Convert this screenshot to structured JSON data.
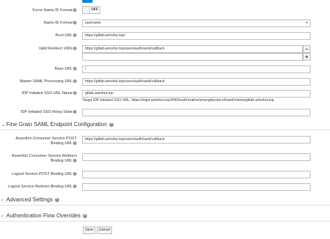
{
  "form": {
    "force_name_id_format": {
      "label": "Force Name ID Format",
      "value": "OFF"
    },
    "name_id_format": {
      "label": "Name ID Format",
      "value": "username"
    },
    "root_url": {
      "label": "Root URL",
      "value": "https://gitlab.arieshui.top/"
    },
    "valid_redirect_uris": {
      "label": "Valid Redirect URIs",
      "value": "https://gitlab.arieshui.top/users/auth/saml/callback",
      "remove_label": "−",
      "add_label": "+"
    },
    "base_url": {
      "label": "Base URL",
      "value": "/"
    },
    "master_saml_processing_url": {
      "label": "Master SAML Processing URL",
      "value": "https://gitlab.arieshui.top/users/auth/saml/callback"
    },
    "idp_initiated_sso_url_name": {
      "label": "IDP Initiated SSO URL Name",
      "value": "gitlab.arieshui.top",
      "hint": "Target IDP initiated SSO URL: https://login.arieshui.top:8443/auth/realms/yinengi/protocol/saml/clients/gitlab.arieshui.top"
    },
    "idp_initiated_sso_relay_state": {
      "label": "IDP Initiated SSO Relay State",
      "value": ""
    }
  },
  "fine_grain": {
    "title": "Fine Grain SAML Endpoint Configuration",
    "acs_post": {
      "label_line1": "Assertion Consumer Service POST",
      "label_line2": "Binding URL",
      "value": "https://gitlab.arieshui.top/users/auth/saml/callback"
    },
    "acs_redirect": {
      "label_line1": "Assertion Consumer Service Redirect",
      "label_line2": "Binding URL",
      "value": ""
    },
    "logout_post": {
      "label": "Logout Service POST Binding URL",
      "value": ""
    },
    "logout_redirect": {
      "label": "Logout Service Redirect Binding URL",
      "value": ""
    }
  },
  "sections": {
    "advanced_settings": "Advanced Settings",
    "auth_flow_overrides": "Authentication Flow Overrides"
  },
  "actions": {
    "save": "Save",
    "cancel": "Cancel"
  },
  "icons": {
    "help": "question-circle-icon",
    "expand": "chevron-right-icon",
    "collapse": "chevron-down-icon",
    "dropdown": "caret-down-icon"
  },
  "colors": {
    "toggle_on": "#0088ce",
    "border": "#bbbbbb",
    "help_icon": "#8c8c8c"
  }
}
